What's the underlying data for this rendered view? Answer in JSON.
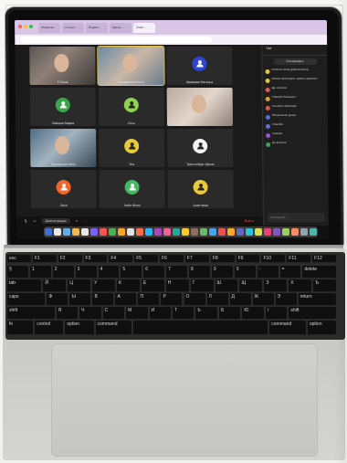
{
  "colors": {
    "tabbar": "#d9c6e6",
    "meeting_bg": "#1a1a1a",
    "speaker_outline": "#e6c64a",
    "leave": "#ff5a4f"
  },
  "browser": {
    "tabs": [
      "Формула...",
      "Статья...",
      "Яндекс...",
      "Курсы...",
      "Zoom..."
    ],
    "active_tab": 4
  },
  "meeting": {
    "participants": [
      {
        "name": "Р. Инна",
        "kind": "camera",
        "style": "cam1"
      },
      {
        "name": "Кашкарова Олеся",
        "kind": "camera",
        "style": "cam2"
      },
      {
        "name": "Кравцова Наталья",
        "kind": "avatar",
        "color": "#2f45d8",
        "icon": "user-icon"
      },
      {
        "name": "Зайцева Мария",
        "kind": "avatar",
        "color": "#3aa64a",
        "icon": "user-icon"
      },
      {
        "name": "Сать",
        "kind": "avatar",
        "color": "#8fd14f",
        "icon": "user-icon"
      },
      {
        "name": "",
        "kind": "camera",
        "style": "cam3"
      },
      {
        "name": "Коршунова Нина",
        "kind": "camera",
        "style": "cam4"
      },
      {
        "name": "Эль",
        "kind": "avatar",
        "color": "#e8c93a",
        "icon": "user-icon"
      },
      {
        "name": "Трахтенберг Ирина",
        "kind": "avatar",
        "color": "#f2f2f2",
        "icon": "user-icon"
      },
      {
        "name": "Лиса",
        "kind": "avatar",
        "color": "#f0662c",
        "icon": "user-icon"
      },
      {
        "name": "Чиби Юлия",
        "kind": "avatar",
        "color": "#44b865",
        "icon": "user-icon"
      },
      {
        "name": "Анастасия",
        "kind": "avatar",
        "color": "#e8c93a",
        "icon": "user-icon"
      }
    ],
    "controls": {
      "share": "Демонстрация",
      "leave": "Выйти"
    }
  },
  "chat": {
    "title": "Чат",
    "button": "Скопировать",
    "messages": [
      {
        "color": "#e0c33e",
        "text": "Коллеги, всем добрый вечер"
      },
      {
        "color": "#e0c33e",
        "text": "Можно посмотреть запись занятия?"
      },
      {
        "color": "#e05a4a",
        "text": "Да, конечно"
      },
      {
        "color": "#d9a233",
        "text": "Спасибо большое!"
      },
      {
        "color": "#e05a4a",
        "text": "Ссылка в описании"
      },
      {
        "color": "#5a6ee0",
        "text": "Объяснение урока"
      },
      {
        "color": "#5a6ee0",
        "text": "Спасибо"
      },
      {
        "color": "#9a4fd4",
        "text": "Хорошо"
      },
      {
        "color": "#3ea05a",
        "text": "До встречи"
      }
    ],
    "input_placeholder": "Сообщение..."
  },
  "dock_colors": [
    "#3a6fd8",
    "#e8e8e8",
    "#5ab0f0",
    "#f0b84a",
    "#e8e8e8",
    "#7b61ff",
    "#ff5252",
    "#4caf50",
    "#f5a623",
    "#e0e0e0",
    "#ff7043",
    "#29b6f6",
    "#ab47bc",
    "#f06292",
    "#26a69a",
    "#ffca28",
    "#8d6e63",
    "#66bb6a",
    "#42a5f5",
    "#ef5350",
    "#ffa726",
    "#5c6bc0",
    "#26c6da",
    "#d4e157",
    "#ec407a",
    "#7e57c2",
    "#9ccc65",
    "#ff8a65",
    "#90a4ae",
    "#4db6ac"
  ],
  "keyboard": {
    "rows": [
      [
        "esc",
        "F1",
        "F2",
        "F3",
        "F4",
        "F5",
        "F6",
        "F7",
        "F8",
        "F9",
        "F10",
        "F11",
        "F12"
      ],
      [
        "§",
        "1",
        "2",
        "3",
        "4",
        "5",
        "6",
        "7",
        "8",
        "9",
        "0",
        "-",
        "=",
        "delete"
      ],
      [
        "tab",
        "Й",
        "Ц",
        "У",
        "К",
        "Е",
        "Н",
        "Г",
        "Ш",
        "Щ",
        "З",
        "Х",
        "Ъ"
      ],
      [
        "caps",
        "Ф",
        "Ы",
        "В",
        "А",
        "П",
        "Р",
        "О",
        "Л",
        "Д",
        "Ж",
        "Э",
        "return"
      ],
      [
        "shift",
        "Я",
        "Ч",
        "С",
        "М",
        "И",
        "Т",
        "Ь",
        "Б",
        "Ю",
        "/",
        "shift"
      ],
      [
        "fn",
        "control",
        "option",
        "command",
        "",
        "command",
        "option"
      ]
    ]
  }
}
